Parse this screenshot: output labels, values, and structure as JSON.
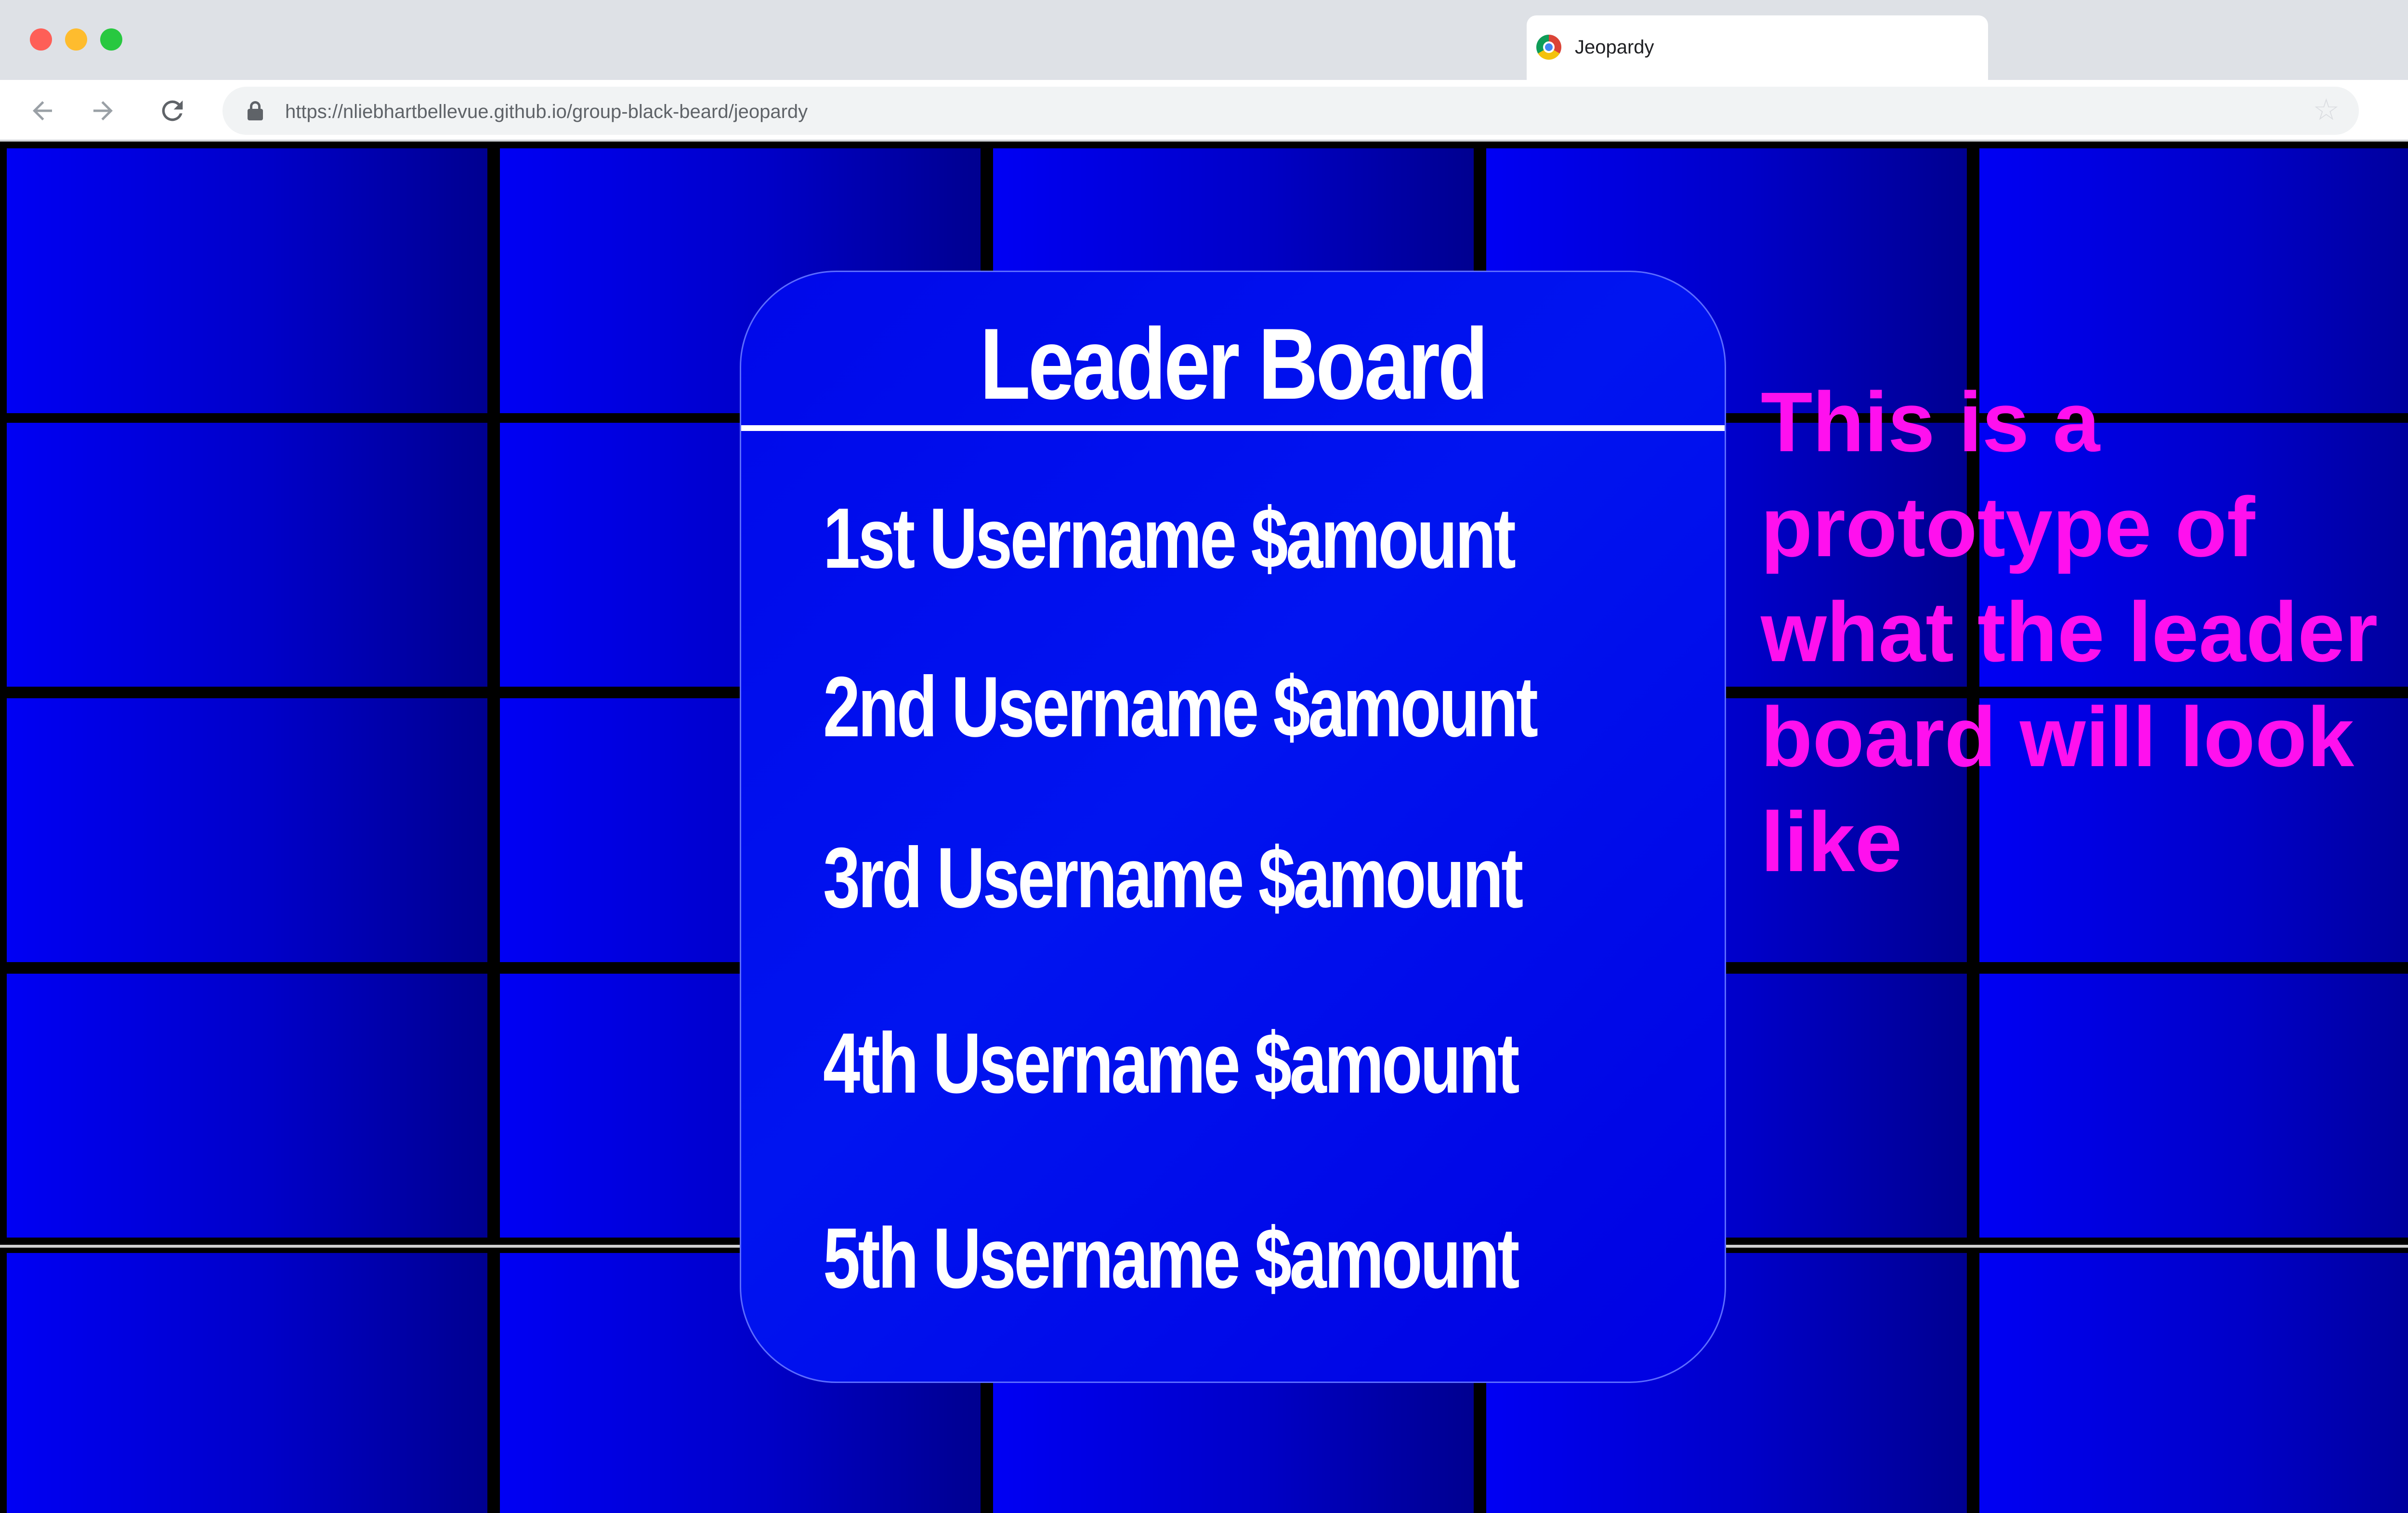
{
  "browser": {
    "tab_title": "Jeopardy",
    "url": "https://nliebhartbellevue.github.io/group-black-beard/jeopardy",
    "icons": {
      "back": "arrow-back-icon",
      "forward": "arrow-forward-icon",
      "reload": "reload-icon",
      "lock": "lock-icon",
      "bookmark": "star-icon",
      "menu": "kebab-menu-icon"
    }
  },
  "leaderboard": {
    "title": "Leader Board",
    "entries": [
      "1st Username $amount",
      "2nd Username $amount",
      "3rd Username $amount",
      "4th Username $amount",
      "5th Username $amount"
    ]
  },
  "annotation": {
    "text": "This is a prototype of what the leader board will look like"
  },
  "colors": {
    "tile_blue": "#0000f4",
    "annotation_magenta": "#ff10ee"
  }
}
